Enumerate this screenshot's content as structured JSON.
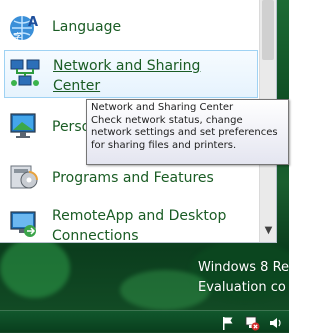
{
  "control_panel": {
    "items": [
      {
        "label_lines": [
          "Language"
        ],
        "icon": "language-icon"
      },
      {
        "label_lines": [
          "Network and Sharing ",
          "Center"
        ],
        "icon": "network-sharing-icon"
      },
      {
        "label_lines": [
          "Perso"
        ],
        "icon": "personalization-icon"
      },
      {
        "label_lines": [
          "Programs and Features"
        ],
        "icon": "programs-features-icon"
      },
      {
        "label_lines": [
          "RemoteApp and Desktop",
          "Connections"
        ],
        "icon": "remoteapp-icon"
      }
    ]
  },
  "tooltip": {
    "lines": [
      "Network and Sharing Center",
      "Check network status, change",
      "network settings and set preferences",
      "for sharing files and printers."
    ]
  },
  "desktop": {
    "watermark_lines": [
      "Windows 8 Re",
      "Evaluation co"
    ]
  },
  "taskbar": {
    "tray_icons": [
      "action-center-flag-icon",
      "network-no-connection-icon",
      "volume-icon"
    ]
  },
  "colors": {
    "link_green": "#1a5c24",
    "hover_border": "#9fd2f3",
    "desktop_green": "#0f4f24"
  }
}
